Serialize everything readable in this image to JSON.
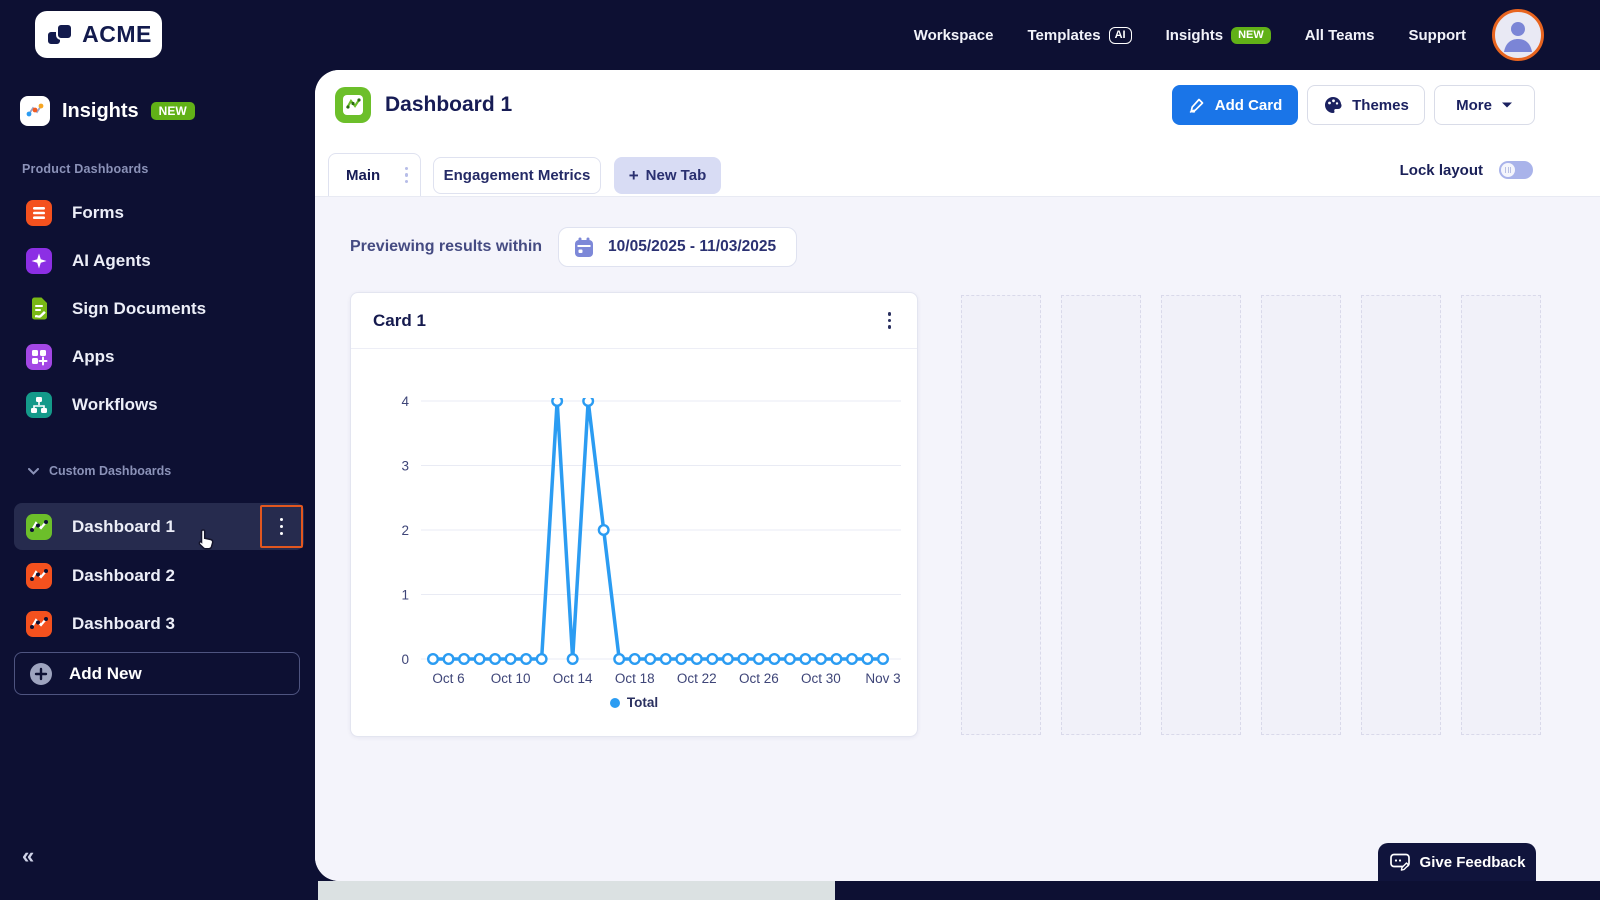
{
  "topnav": {
    "items": [
      {
        "label": "Workspace"
      },
      {
        "label": "Templates",
        "badge": "AI"
      },
      {
        "label": "Insights",
        "badge": "NEW"
      },
      {
        "label": "All Teams"
      },
      {
        "label": "Support"
      }
    ]
  },
  "sidebar": {
    "logo": "ACME",
    "product_name": "Insights",
    "product_badge": "NEW",
    "section_product": "Product Dashboards",
    "product_items": [
      {
        "label": "Forms"
      },
      {
        "label": "AI Agents"
      },
      {
        "label": "Sign Documents"
      },
      {
        "label": "Apps"
      },
      {
        "label": "Workflows"
      }
    ],
    "section_custom": "Custom Dashboards",
    "custom_items": [
      {
        "label": "Dashboard 1",
        "selected": true
      },
      {
        "label": "Dashboard 2",
        "selected": false
      },
      {
        "label": "Dashboard 3",
        "selected": false
      }
    ],
    "add_new": "Add New",
    "collapse": "«"
  },
  "header": {
    "title": "Dashboard 1",
    "add_card": "Add Card",
    "themes": "Themes",
    "more": "More"
  },
  "tabs": {
    "main": "Main",
    "engagement": "Engagement Metrics",
    "new_tab_plus": "+",
    "new_tab": "New Tab",
    "lock_layout": "Lock layout",
    "lock_state": "off"
  },
  "filter": {
    "label": "Previewing results within",
    "range": "10/05/2025 - 11/03/2025"
  },
  "card": {
    "title": "Card 1"
  },
  "chart_data": {
    "type": "line",
    "title": "Card 1",
    "legend": "Total",
    "legend_position": "bottom",
    "grid": "horizontal",
    "line_color": "#2b9cf2",
    "dates": [
      "Oct 5",
      "Oct 6",
      "Oct 7",
      "Oct 8",
      "Oct 9",
      "Oct 10",
      "Oct 11",
      "Oct 12",
      "Oct 13",
      "Oct 14",
      "Oct 15",
      "Oct 16",
      "Oct 17",
      "Oct 18",
      "Oct 19",
      "Oct 20",
      "Oct 21",
      "Oct 22",
      "Oct 23",
      "Oct 24",
      "Oct 25",
      "Oct 26",
      "Oct 27",
      "Oct 28",
      "Oct 29",
      "Oct 30",
      "Oct 31",
      "Nov 1",
      "Nov 2",
      "Nov 3"
    ],
    "values": [
      0,
      0,
      0,
      0,
      0,
      0,
      0,
      0,
      4,
      0,
      4,
      2,
      0,
      0,
      0,
      0,
      0,
      0,
      0,
      0,
      0,
      0,
      0,
      0,
      0,
      0,
      0,
      0,
      0,
      0
    ],
    "x_tick_indices": [
      1,
      5,
      9,
      13,
      17,
      21,
      25,
      29
    ],
    "x_tick_labels": [
      "Oct 6",
      "Oct 10",
      "Oct 14",
      "Oct 18",
      "Oct 22",
      "Oct 26",
      "Oct 30",
      "Nov 3"
    ],
    "y_ticks": [
      0,
      1,
      2,
      3,
      4
    ],
    "ylim": [
      0,
      4
    ]
  },
  "grid": {
    "placeholder_columns": 6
  },
  "feedback": {
    "label": "Give Feedback"
  },
  "colors": {
    "primary_blue": "#1a75e8",
    "chart_blue": "#2b9cf2",
    "badge_green": "#61b117",
    "selection_orange": "#e2571f",
    "navy": "#0d1033"
  }
}
